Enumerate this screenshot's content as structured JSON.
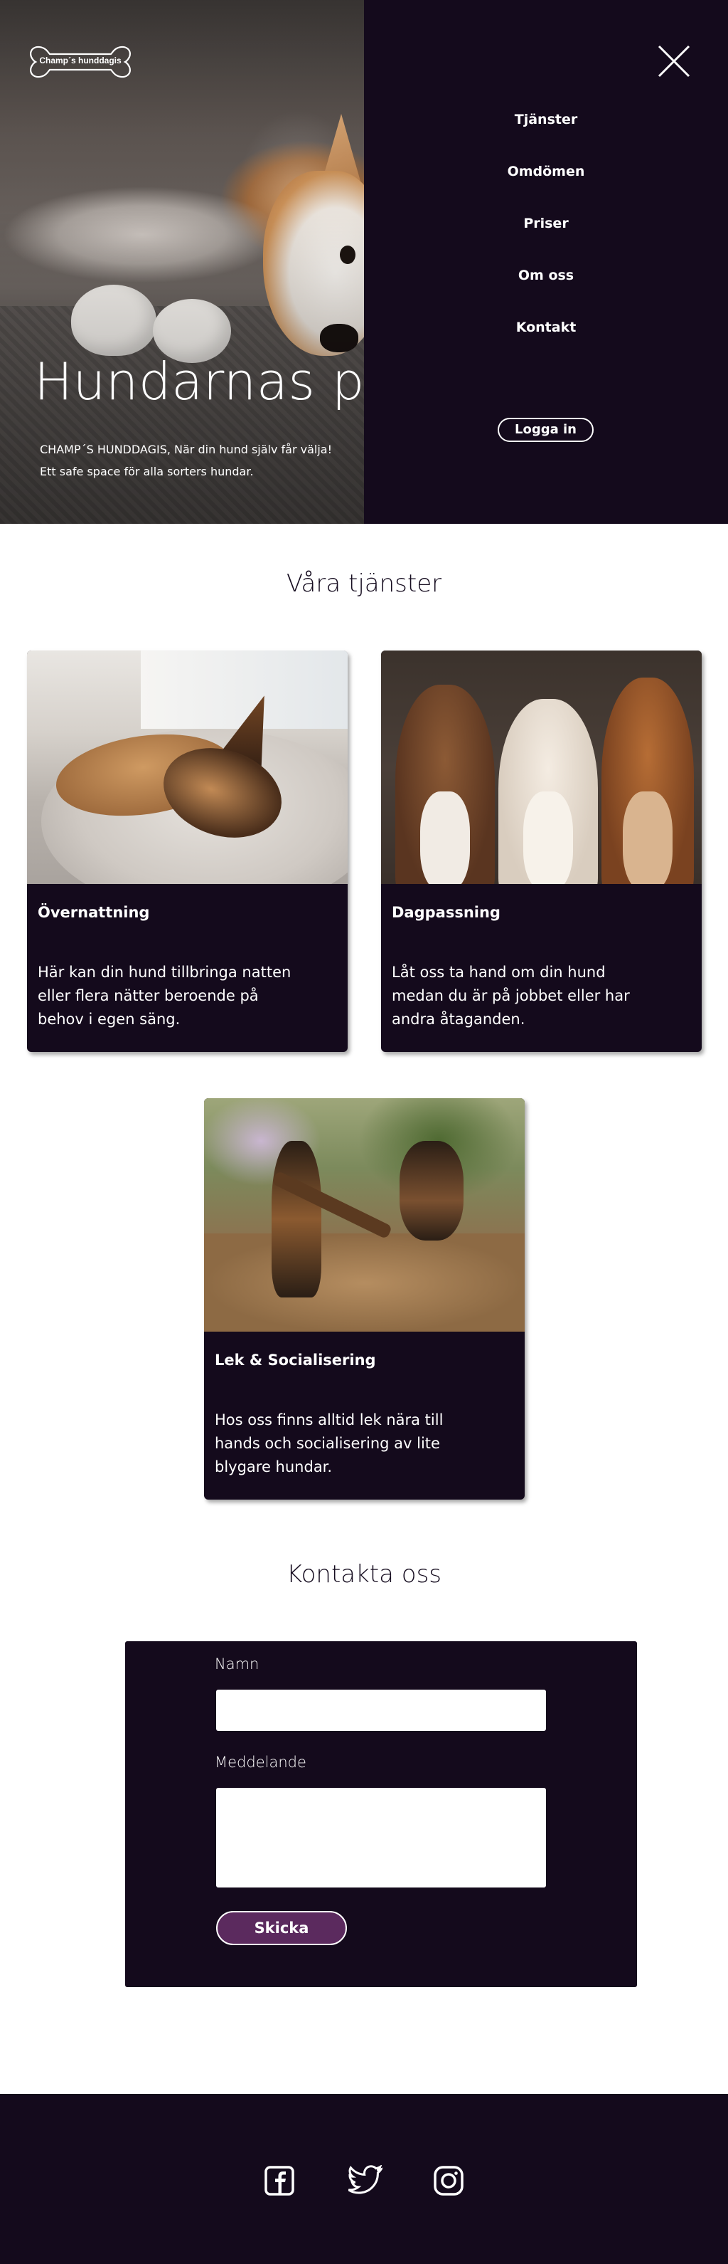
{
  "brand": {
    "logo_text": "Champ´s hunddagis"
  },
  "hero": {
    "title": "Hundarnas paradis",
    "subtitle_line1": "CHAMP´S HUNDDAGIS, När din hund själv får välja!",
    "subtitle_line2": "Ett safe space för alla sorters hundar."
  },
  "nav": {
    "items": [
      {
        "label": "Tjänster"
      },
      {
        "label": "Omdömen"
      },
      {
        "label": "Priser"
      },
      {
        "label": "Om oss"
      },
      {
        "label": "Kontakt"
      }
    ],
    "login_label": "Logga in",
    "close_icon": "close-icon"
  },
  "services": {
    "heading": "Våra tjänster",
    "cards": [
      {
        "title": "Övernattning",
        "text": "Här kan din hund tillbringa natten eller flera nätter beroende på behov i egen säng.",
        "image": "sleeping-dog-photo"
      },
      {
        "title": "Dagpassning",
        "text": "Låt oss ta hand om din hund medan du är på jobbet eller har andra åtaganden.",
        "image": "three-dogs-photo"
      },
      {
        "title": "Lek & Socialisering",
        "text": "Hos oss finns alltid lek nära till hands och socialisering av lite blygare hundar.",
        "image": "dogs-playing-photo"
      }
    ]
  },
  "contact": {
    "heading": "Kontakta oss",
    "name_label": "Namn",
    "name_value": "",
    "message_label": "Meddelande",
    "message_value": "",
    "send_label": "Skicka"
  },
  "footer": {
    "social": [
      {
        "icon": "facebook-icon"
      },
      {
        "icon": "twitter-icon"
      },
      {
        "icon": "instagram-icon"
      }
    ]
  },
  "colors": {
    "panel": "#140a1c",
    "button_accent": "#5b2a5e",
    "text_light": "#ffffff",
    "text_dark": "#160d20"
  }
}
